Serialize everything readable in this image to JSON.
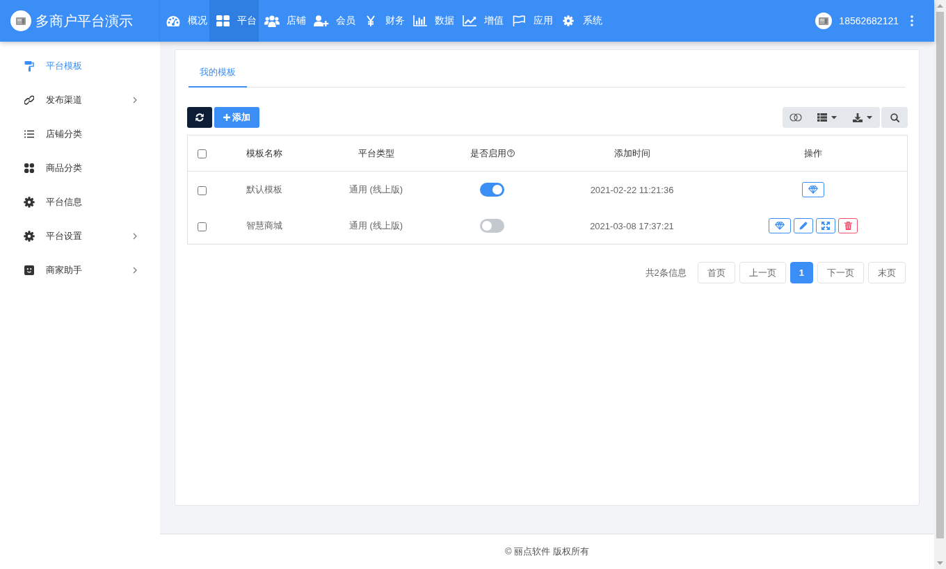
{
  "header": {
    "brand": "多商户平台演示",
    "nav": [
      {
        "label": "概况",
        "selected": false
      },
      {
        "label": "平台",
        "selected": true
      },
      {
        "label": "店铺",
        "selected": false
      },
      {
        "label": "会员",
        "selected": false
      },
      {
        "label": "财务",
        "selected": false
      },
      {
        "label": "数据",
        "selected": false
      },
      {
        "label": "增值",
        "selected": false
      },
      {
        "label": "应用",
        "selected": false
      },
      {
        "label": "系统",
        "selected": false
      }
    ],
    "user": "18562682121"
  },
  "sidebar": {
    "items": [
      {
        "label": "平台模板",
        "selected": true,
        "has_submenu": false
      },
      {
        "label": "发布渠道",
        "selected": false,
        "has_submenu": true
      },
      {
        "label": "店铺分类",
        "selected": false,
        "has_submenu": false
      },
      {
        "label": "商品分类",
        "selected": false,
        "has_submenu": false
      },
      {
        "label": "平台信息",
        "selected": false,
        "has_submenu": false
      },
      {
        "label": "平台设置",
        "selected": false,
        "has_submenu": true
      },
      {
        "label": "商家助手",
        "selected": false,
        "has_submenu": true
      }
    ]
  },
  "tabs": [
    {
      "label": "我的模板",
      "selected": true
    }
  ],
  "toolbar": {
    "add_button": "添加"
  },
  "table": {
    "select_all_checked": false,
    "columns": [
      {
        "label": "模板名称",
        "help": false
      },
      {
        "label": "平台类型",
        "help": false
      },
      {
        "label": "是否启用",
        "help": true
      },
      {
        "label": "添加时间",
        "help": false
      },
      {
        "label": "操作",
        "help": false
      }
    ],
    "rows": [
      {
        "checked": false,
        "name": "默认模板",
        "type": "通用 (线上版)",
        "enabled": true,
        "added": "2021-02-22 11:21:36",
        "actions": [
          {
            "kind": "diamond"
          }
        ]
      },
      {
        "checked": false,
        "name": "智慧商城",
        "type": "通用 (线上版)",
        "enabled": false,
        "added": "2021-03-08 17:37:21",
        "actions": [
          {
            "kind": "diamond"
          },
          {
            "kind": "edit"
          },
          {
            "kind": "expand"
          },
          {
            "kind": "delete"
          }
        ]
      }
    ]
  },
  "pagination": {
    "summary": "共2条信息",
    "buttons": [
      {
        "label": "首页",
        "selected": false
      },
      {
        "label": "上一页",
        "selected": false
      },
      {
        "label": "1",
        "selected": true
      },
      {
        "label": "下一页",
        "selected": false
      },
      {
        "label": "末页",
        "selected": false
      }
    ]
  },
  "footer": {
    "copyright": "© 丽点软件 版权所有"
  }
}
